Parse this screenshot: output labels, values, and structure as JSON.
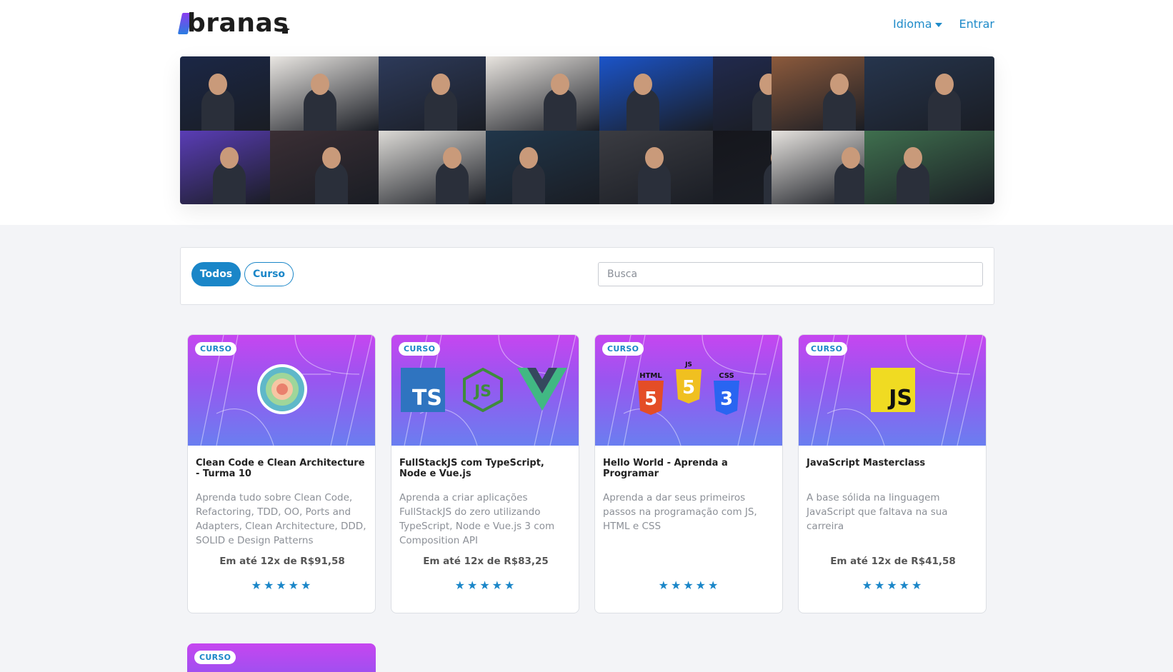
{
  "header": {
    "logo_text": "branas",
    "nav": [
      {
        "label": "Idioma"
      },
      {
        "label": "Entrar"
      }
    ]
  },
  "banner": {
    "tile_colors": [
      "#1b2746",
      "#e9e6e2",
      "#2d3a5a",
      "#e8e4df",
      "#1b54c9",
      "#212a4e",
      "#8c5a3c",
      "#26354d",
      "#5a3db6",
      "#3a2e34",
      "#dcdad6",
      "#20364a",
      "#3b3c42",
      "#15161c",
      "#e6e3df",
      "#3f6f4e"
    ]
  },
  "filters": {
    "todos_label": "Todos",
    "curso_label": "Curso",
    "search_placeholder": "Busca"
  },
  "courses": [
    {
      "badge": "CURSO",
      "title": "Clean Code e Clean Architecture - Turma 10",
      "description": "Aprenda tudo sobre Clean Code, Refactoring, TDD, OO, Ports and Adapters, Clean Architecture, DDD, SOLID e Design Patterns",
      "price": "Em até 12x de R$91,58",
      "rating": 5,
      "stars": "★★★★★",
      "icon": "clean-architecture-icon"
    },
    {
      "badge": "CURSO",
      "title": "FullStackJS com TypeScript, Node e Vue.js",
      "description": "Aprenda a criar aplicações FullStackJS do zero utilizando TypeScript, Node e Vue.js 3 com Composition API",
      "price": "Em até 12x de R$83,25",
      "rating": 5,
      "stars": "★★★★★",
      "icon": "ts-node-vue-icons",
      "icon_labels": {
        "ts": "TS",
        "js": "JS"
      }
    },
    {
      "badge": "CURSO",
      "title": "Hello World - Aprenda a Programar",
      "description": "Aprenda a dar seus primeiros passos na programação com JS, HTML e CSS",
      "price": "",
      "rating": 5,
      "stars": "★★★★★",
      "icon": "html-js-css-icons",
      "icon_labels": {
        "html": "HTML",
        "js": "JS",
        "css": "CSS",
        "five": "5",
        "three": "3"
      }
    },
    {
      "badge": "CURSO",
      "title": "JavaScript Masterclass",
      "description": "A base sólida na linguagem JavaScript que faltava na sua carreira",
      "price": "Em até 12x de R$41,58",
      "rating": 5,
      "stars": "★★★★★",
      "icon": "javascript-icon",
      "icon_labels": {
        "js": "JS"
      }
    }
  ],
  "partial_card": {
    "badge": "CURSO"
  },
  "colors": {
    "accent": "#1a86c8",
    "card_gradient_top": "#c646f0",
    "card_gradient_bottom": "#6a7ef0"
  }
}
